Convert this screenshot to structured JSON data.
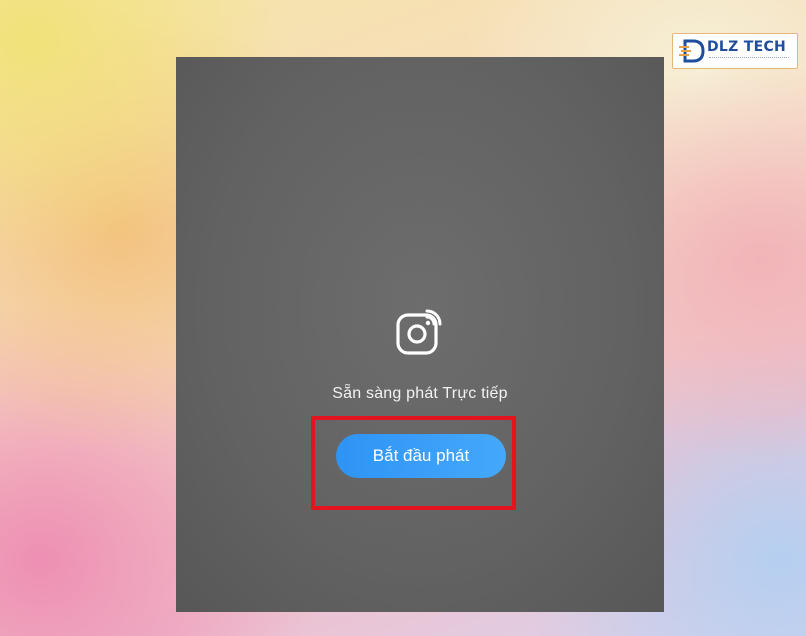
{
  "brand": {
    "name": "DLZ TECH",
    "logo_color": "#1f4e9c",
    "logo_border_color": "#e6b77a"
  },
  "live_screen": {
    "icon": "instagram-live-icon",
    "status_text": "Sẵn sàng phát Trực tiếp",
    "start_button_label": "Bắt đầu phát",
    "button_color": "#2f93f5",
    "highlight_color": "#e3141d"
  }
}
